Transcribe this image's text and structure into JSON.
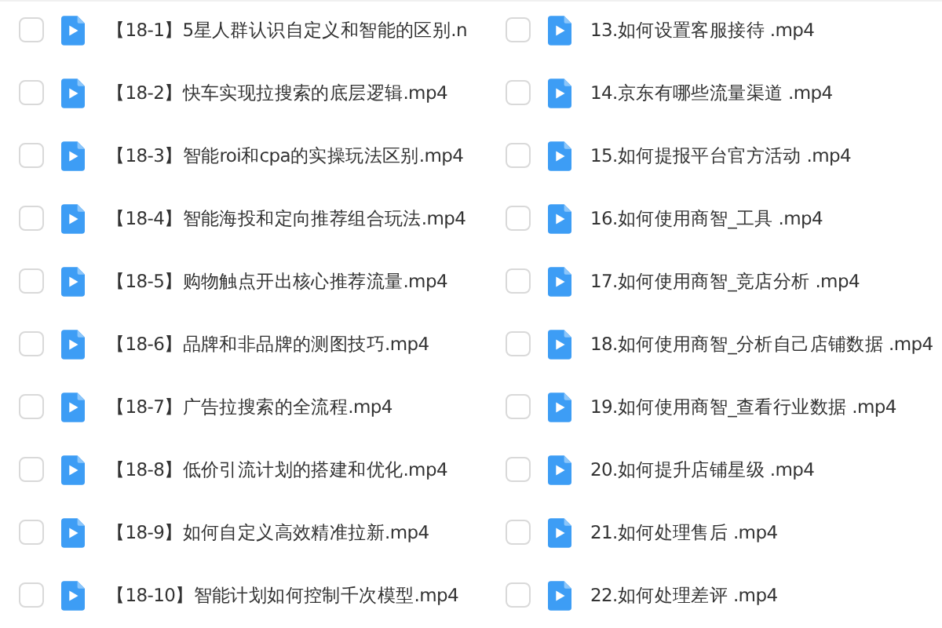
{
  "columns": [
    {
      "files": [
        {
          "name": "【18-1】5星人群认识自定义和智能的区别.n",
          "checked": false
        },
        {
          "name": "【18-2】快车实现拉搜索的底层逻辑.mp4",
          "checked": false
        },
        {
          "name": "【18-3】智能roi和cpa的实操玩法区别.mp4",
          "checked": false
        },
        {
          "name": "【18-4】智能海投和定向推荐组合玩法.mp4",
          "checked": false
        },
        {
          "name": "【18-5】购物触点开出核心推荐流量.mp4",
          "checked": false
        },
        {
          "name": "【18-6】品牌和非品牌的测图技巧.mp4",
          "checked": false
        },
        {
          "name": "【18-7】广告拉搜索的全流程.mp4",
          "checked": false
        },
        {
          "name": "【18-8】低价引流计划的搭建和优化.mp4",
          "checked": false
        },
        {
          "name": "【18-9】如何自定义高效精准拉新.mp4",
          "checked": false
        },
        {
          "name": "【18-10】智能计划如何控制千次模型.mp4",
          "checked": false
        }
      ]
    },
    {
      "files": [
        {
          "name": "13.如何设置客服接待 .mp4",
          "checked": false
        },
        {
          "name": "14.京东有哪些流量渠道 .mp4",
          "checked": false
        },
        {
          "name": "15.如何提报平台官方活动 .mp4",
          "checked": false
        },
        {
          "name": "16.如何使用商智_工具 .mp4",
          "checked": false
        },
        {
          "name": "17.如何使用商智_竞店分析 .mp4",
          "checked": false
        },
        {
          "name": "18.如何使用商智_分析自己店铺数据 .mp4",
          "checked": false
        },
        {
          "name": "19.如何使用商智_查看行业数据 .mp4",
          "checked": false
        },
        {
          "name": "20.如何提升店铺星级 .mp4",
          "checked": false
        },
        {
          "name": "21.如何处理售后 .mp4",
          "checked": false
        },
        {
          "name": "22.如何处理差评 .mp4",
          "checked": false
        }
      ]
    }
  ]
}
